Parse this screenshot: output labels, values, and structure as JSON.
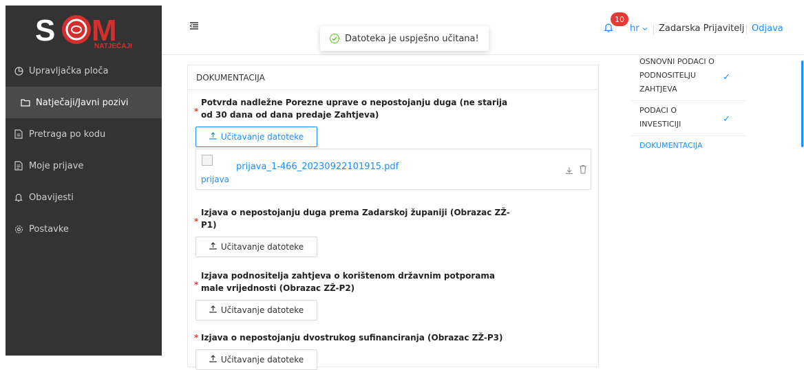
{
  "logo": {
    "letters": "SOM",
    "sub": "NATJEČAJI"
  },
  "sidebar": {
    "items": [
      {
        "label": "Upravljačka ploča",
        "icon": "dashboard-icon"
      },
      {
        "label": "Natječaji/Javni pozivi",
        "icon": "folder-icon",
        "active": true
      },
      {
        "label": "Pretraga po kodu",
        "icon": "document-icon"
      },
      {
        "label": "Moje prijave",
        "icon": "file-icon"
      },
      {
        "label": "Obavijesti",
        "icon": "bell-icon"
      },
      {
        "label": "Postavke",
        "icon": "gear-icon"
      }
    ]
  },
  "header": {
    "toast": "Datoteka je uspješno učitana!",
    "notifications": "10",
    "lang": "hr",
    "user": "Zadarska Prijavitelj",
    "logout": "Odjava"
  },
  "main": {
    "section_title": "DOKUMENTACIJA",
    "documents": [
      {
        "title": "Potvrda nadležne Porezne uprave o nepostojanju duga (ne starija od 30 dana od dana predaje Zahtjeva)",
        "button": "Učitavanje datoteke",
        "uploaded": true
      },
      {
        "title": "Izjava o nepostojanju duga prema Zadarskoj županiji (Obrazac ZŽ-P1)",
        "button": "Učitavanje datoteke"
      },
      {
        "title": "Izjava podnositelja zahtjeva o korištenom državnim potporama male vrijednosti (Obrazac ZŽ-P2)",
        "button": "Učitavanje datoteke"
      },
      {
        "title": "Izjava o nepostojanju dvostrukog sufinanciranja (Obrazac ZŽ-P3)",
        "button": "Učitavanje datoteke"
      }
    ],
    "file": {
      "name": "prijava_1-466_20230922101915.pdf",
      "alt": "prijava"
    }
  },
  "steps": [
    {
      "label": "OSNOVNI PODACI O PODNOSITELJU ZAHTJEVA",
      "done": true
    },
    {
      "label": "PODACI O INVESTICIJI",
      "done": true
    },
    {
      "label": "DOKUMENTACIJA",
      "active": true
    }
  ],
  "colors": {
    "sidebar": "#333333",
    "accent": "#1890ff",
    "badge": "#e53935",
    "logo_red": "#d32f2f"
  }
}
